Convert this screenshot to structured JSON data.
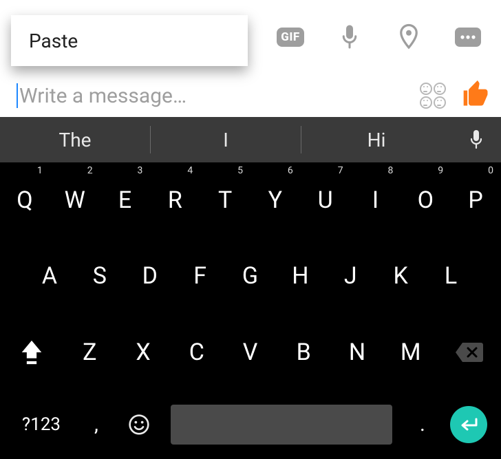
{
  "context_menu": {
    "paste_label": "Paste"
  },
  "toolbar": {
    "gif_label": "GIF"
  },
  "composer": {
    "placeholder": "Write a message…"
  },
  "keyboard": {
    "suggestions": [
      "The",
      "I",
      "Hi"
    ],
    "row1": [
      {
        "k": "Q",
        "n": "1"
      },
      {
        "k": "W",
        "n": "2"
      },
      {
        "k": "E",
        "n": "3"
      },
      {
        "k": "R",
        "n": "4"
      },
      {
        "k": "T",
        "n": "5"
      },
      {
        "k": "Y",
        "n": "6"
      },
      {
        "k": "U",
        "n": "7"
      },
      {
        "k": "I",
        "n": "8"
      },
      {
        "k": "O",
        "n": "9"
      },
      {
        "k": "P",
        "n": "0"
      }
    ],
    "row2": [
      "A",
      "S",
      "D",
      "F",
      "G",
      "H",
      "J",
      "K",
      "L"
    ],
    "row3": [
      "Z",
      "X",
      "C",
      "V",
      "B",
      "N",
      "M"
    ],
    "symbols_label": "?123",
    "comma": ",",
    "period": "."
  }
}
